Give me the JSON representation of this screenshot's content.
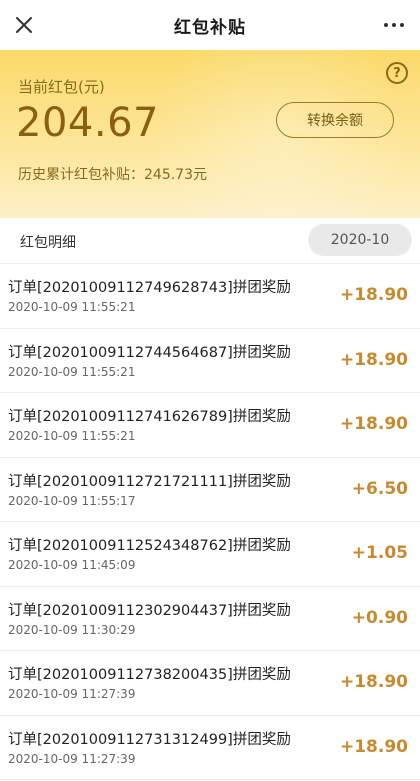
{
  "topbar": {
    "title": "红包补贴",
    "close_icon": "close-icon",
    "more_icon": "more-icon"
  },
  "hero": {
    "label": "当前红包(元)",
    "amount": "204.67",
    "convert_label": "转换余额",
    "total_text": "历史累计红包补贴：245.73元",
    "help_icon": "help-icon",
    "help_glyph": "?"
  },
  "section": {
    "title": "红包明细",
    "month": "2020-10"
  },
  "items": [
    {
      "title": "订单[2020100911274962874​3]拼团奖励",
      "time": "2020-10-09 11:55:21",
      "amount": "+18.90"
    },
    {
      "title": "订单[20201009112744564687]拼团奖励",
      "time": "2020-10-09 11:55:21",
      "amount": "+18.90"
    },
    {
      "title": "订单[20201009112741626789]拼团奖励",
      "time": "2020-10-09 11:55:21",
      "amount": "+18.90"
    },
    {
      "title": "订单[20201009112721721111]拼团奖励",
      "time": "2020-10-09 11:55:17",
      "amount": "+6.50"
    },
    {
      "title": "订单[20201009112524348762]拼团奖励",
      "time": "2020-10-09 11:45:09",
      "amount": "+1.05"
    },
    {
      "title": "订单[20201009112302904437]拼团奖励",
      "time": "2020-10-09 11:30:29",
      "amount": "+0.90"
    },
    {
      "title": "订单[20201009112738200435]拼团奖励",
      "time": "2020-10-09 11:27:39",
      "amount": "+18.90"
    },
    {
      "title": "订单[20201009112731312499]拼团奖励",
      "time": "2020-10-09 11:27:39",
      "amount": "+18.90"
    }
  ],
  "colors": {
    "accent": "#c88a2e",
    "hero_top": "#fbd96a",
    "hero_bottom": "#fdf0c6"
  }
}
